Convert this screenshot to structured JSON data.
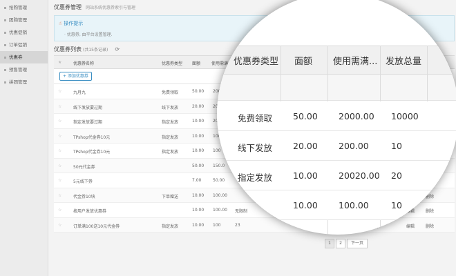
{
  "sidebar": {
    "items": [
      {
        "label": "抢购管理"
      },
      {
        "label": "团购管理"
      },
      {
        "label": "优惠促销"
      },
      {
        "label": "订单促销"
      },
      {
        "label": "优惠券",
        "active": true
      },
      {
        "label": "预售管理"
      },
      {
        "label": "拼团管理"
      }
    ]
  },
  "header": {
    "title": "优惠券管理",
    "subtitle": "网站系统优惠券索引与管理"
  },
  "tip": {
    "title": "操作提示",
    "text": "· 优惠券, 由平台设置管理."
  },
  "list": {
    "title": "优惠券列表",
    "count": "(共15条记录)",
    "add_label": "+ 添加优惠券"
  },
  "table": {
    "columns": [
      "优惠券名称",
      "优惠券类型",
      "面额",
      "使用需满..."
    ],
    "rows": [
      {
        "name": "九月九",
        "type": "免费领取",
        "amount": "50.00",
        "min": "2000"
      },
      {
        "name": "线下发放要过期",
        "type": "线下发放",
        "amount": "20.00",
        "min": "200"
      },
      {
        "name": "指定发放要过期",
        "type": "指定发放",
        "amount": "10.00",
        "min": "200"
      },
      {
        "name": "TPshop代金券10元",
        "type": "指定发放",
        "amount": "10.00",
        "min": "100"
      },
      {
        "name": "TPshop代金券10元",
        "type": "指定发放",
        "amount": "10.00",
        "min": "100"
      },
      {
        "name": "50元代金券",
        "type": "",
        "amount": "50.00",
        "min": "150.0"
      },
      {
        "name": "5元线下券",
        "type": "",
        "amount": "7.00",
        "min": "50.00"
      },
      {
        "name": "代金券10块",
        "type": "下单赠送",
        "amount": "10.00",
        "min": "100.00"
      },
      {
        "name": "按用户发放优惠券",
        "type": "",
        "amount": "10.00",
        "min": "100.00",
        "extra": "无限制"
      },
      {
        "name": "订单满100送10元代金券",
        "type": "指定发放",
        "amount": "10.00",
        "min": "100",
        "extra": "23"
      }
    ],
    "ops": {
      "edit": "编辑",
      "delete": "删除",
      "view": "查看",
      "issue": "发放"
    }
  },
  "pager": {
    "page1": "1",
    "page2": "2",
    "next": "下一页"
  },
  "magnifier": {
    "headers": [
      "优惠券类型",
      "面额",
      "使用需满...",
      "发放总量"
    ],
    "rows": [
      [
        "免费领取",
        "50.00",
        "2000.00",
        "10000"
      ],
      [
        "线下发放",
        "20.00",
        "200.00",
        "10"
      ],
      [
        "指定发放",
        "10.00",
        "20020.00",
        "20"
      ],
      [
        "",
        "10.00",
        "100.00",
        "10"
      ]
    ]
  }
}
